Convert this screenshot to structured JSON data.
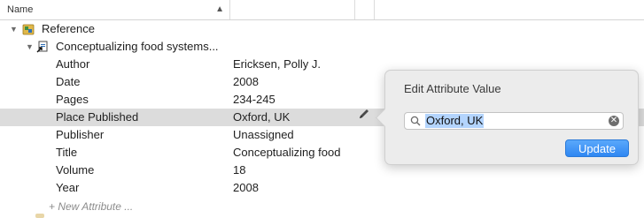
{
  "header": {
    "name_col": "Name",
    "sort_indicator": "▲"
  },
  "tree": {
    "root_label": "Reference",
    "root_icon": "reference-folder-icon",
    "item_label": "Conceptualizing food systems...",
    "item_icon": "document-link-icon",
    "attributes": [
      {
        "key": "Author",
        "value": "Ericksen, Polly J."
      },
      {
        "key": "Date",
        "value": "2008"
      },
      {
        "key": "Pages",
        "value": "234-245"
      },
      {
        "key": "Place Published",
        "value": "Oxford, UK"
      },
      {
        "key": "Publisher",
        "value": "Unassigned"
      },
      {
        "key": "Title",
        "value": "Conceptualizing food"
      },
      {
        "key": "Volume",
        "value": "18"
      },
      {
        "key": "Year",
        "value": "2008"
      }
    ],
    "new_attribute_label": "+ New Attribute ..."
  },
  "popover": {
    "title": "Edit Attribute Value",
    "input_value": "Oxford, UK",
    "update_label": "Update"
  },
  "colors": {
    "selection": "#dcdcdc",
    "accent": "#2f87f2",
    "text_selection": "#b3d4fd"
  }
}
